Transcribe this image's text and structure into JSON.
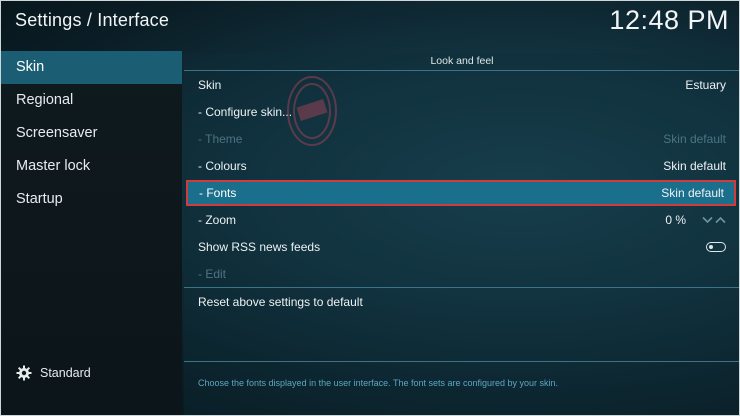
{
  "header": {
    "title": "Settings / Interface",
    "clock": "12:48 PM"
  },
  "sidebar": {
    "items": [
      {
        "label": "Skin",
        "active": true
      },
      {
        "label": "Regional",
        "active": false
      },
      {
        "label": "Screensaver",
        "active": false
      },
      {
        "label": "Master lock",
        "active": false
      },
      {
        "label": "Startup",
        "active": false
      }
    ],
    "level_label": "Standard",
    "level_icon": "gear-icon"
  },
  "main": {
    "section_title": "Look and feel",
    "rows": [
      {
        "label": "Skin",
        "value": "Estuary",
        "state": "enabled"
      },
      {
        "label": "- Configure skin...",
        "value": "",
        "state": "enabled"
      },
      {
        "label": "- Theme",
        "value": "Skin default",
        "state": "disabled"
      },
      {
        "label": "- Colours",
        "value": "Skin default",
        "state": "enabled"
      },
      {
        "label": "- Fonts",
        "value": "Skin default",
        "state": "selected"
      },
      {
        "label": "- Zoom",
        "value": "0 %",
        "state": "enabled"
      },
      {
        "label": "Show RSS news feeds",
        "value": "",
        "state": "enabled",
        "toggle": "off"
      },
      {
        "label": "- Edit",
        "value": "",
        "state": "disabled"
      }
    ],
    "reset_label": "Reset above settings to default",
    "help_text": "Choose the fonts displayed in the user interface. The font sets are configured by your skin."
  },
  "colors": {
    "accent": "#1b5e74",
    "selection": "#1a6f8c",
    "selection_border": "#d23b3b",
    "help_text": "#5ea6c0"
  }
}
